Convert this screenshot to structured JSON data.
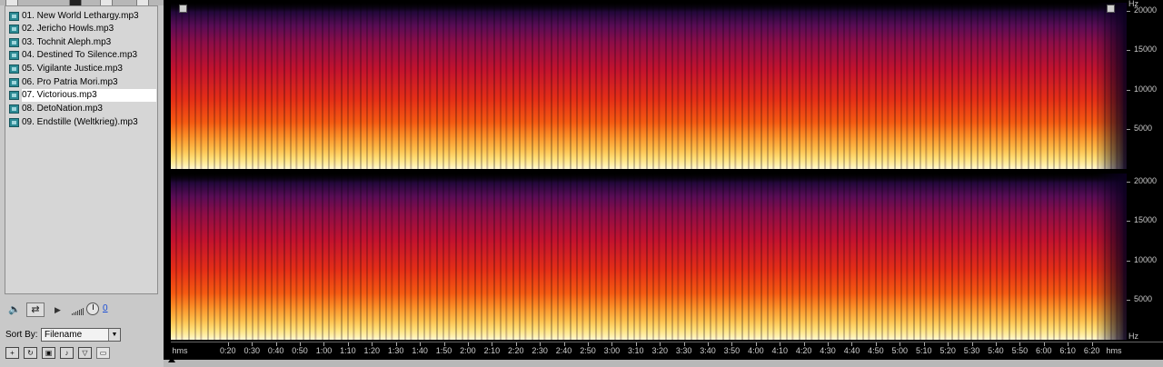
{
  "files": [
    {
      "name": "01. New World Lethargy.mp3",
      "selected": false
    },
    {
      "name": "02. Jericho Howls.mp3",
      "selected": false
    },
    {
      "name": "03. Tochnit Aleph.mp3",
      "selected": false
    },
    {
      "name": "04. Destined To Silence.mp3",
      "selected": false
    },
    {
      "name": "05. Vigilante Justice.mp3",
      "selected": false
    },
    {
      "name": "06. Pro Patria Mori.mp3",
      "selected": false
    },
    {
      "name": "07. Victorious.mp3",
      "selected": true
    },
    {
      "name": "08. DetoNation.mp3",
      "selected": false
    },
    {
      "name": "09. Endstille (Weltkrieg).mp3",
      "selected": false
    }
  ],
  "controls": {
    "volume_value": "0",
    "sort_label": "Sort By:",
    "sort_value": "Filename",
    "icons": [
      "speaker-icon",
      "loop-icon",
      "play-icon",
      "volume-bars-icon",
      "volume-knob-icon"
    ]
  },
  "spectrogram": {
    "channels": 2,
    "top_unit": "Hz",
    "bottom_unit": "Hz",
    "freq_labels": [
      "20000",
      "15000",
      "10000",
      "5000"
    ],
    "freq_values": [
      20000,
      15000,
      10000,
      5000
    ],
    "freq_max": 21000,
    "colors": {
      "low": "#fff8d8",
      "mid": "#e52e17",
      "high": "#5a0c55",
      "floor": "#000000"
    }
  },
  "time_axis": {
    "start_label": "hms",
    "end_label": "hms",
    "total_seconds": 390,
    "labels": [
      "0:20",
      "0:30",
      "0:40",
      "0:50",
      "1:00",
      "1:10",
      "1:20",
      "1:30",
      "1:40",
      "1:50",
      "2:00",
      "2:10",
      "2:20",
      "2:30",
      "2:40",
      "2:50",
      "3:00",
      "3:10",
      "3:20",
      "3:30",
      "3:40",
      "3:50",
      "4:00",
      "4:10",
      "4:20",
      "4:30",
      "4:40",
      "4:50",
      "5:00",
      "5:10",
      "5:20",
      "5:30",
      "5:40",
      "5:50",
      "6:00",
      "6:10",
      "6:20"
    ],
    "label_seconds": [
      20,
      30,
      40,
      50,
      60,
      70,
      80,
      90,
      100,
      110,
      120,
      130,
      140,
      150,
      160,
      170,
      180,
      190,
      200,
      210,
      220,
      230,
      240,
      250,
      260,
      270,
      280,
      290,
      300,
      310,
      320,
      330,
      340,
      350,
      360,
      370,
      380
    ]
  }
}
